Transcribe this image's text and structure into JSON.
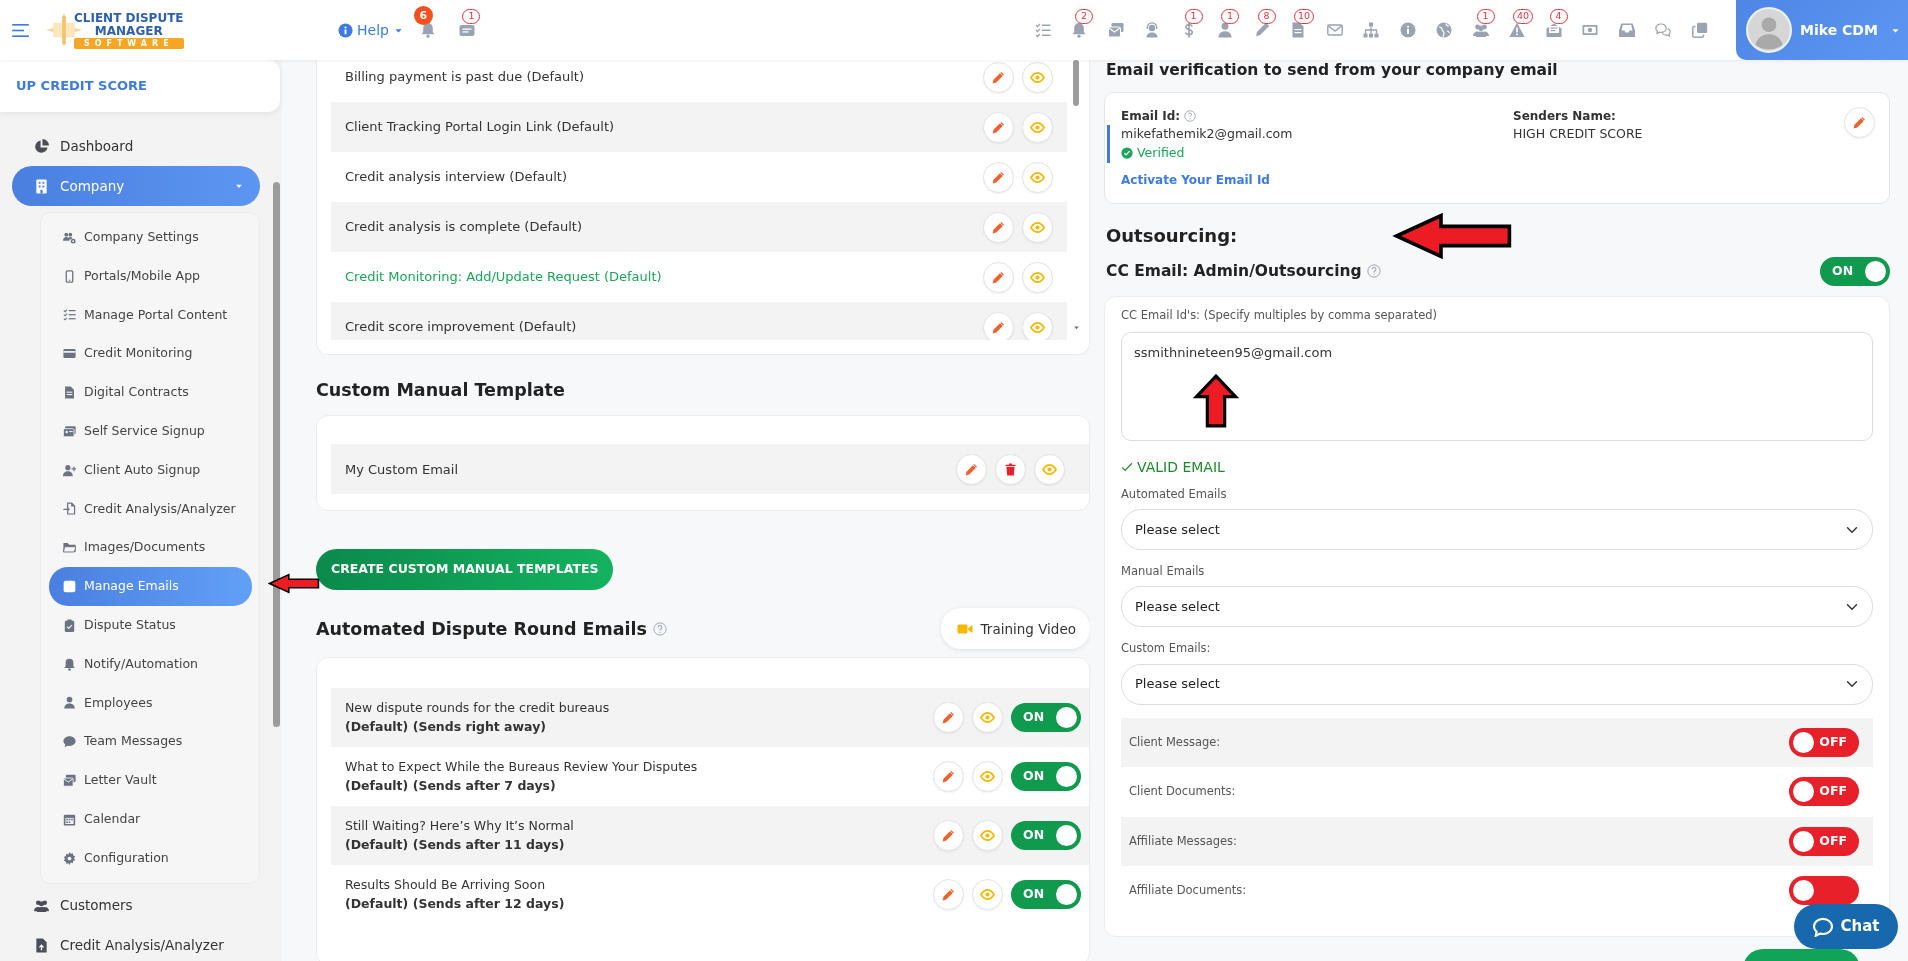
{
  "header": {
    "logo": {
      "line_1": "CLIENT DISPUTE",
      "line_2": "MANAGER",
      "line_3": "SOFTWARE"
    },
    "help": {
      "label": "Help"
    },
    "quick": [
      {
        "badge": "6"
      },
      {
        "badge": "1"
      }
    ],
    "icons": [
      {
        "badged": false
      },
      {
        "badged": true,
        "badge": "2"
      },
      {
        "badged": false
      },
      {
        "badged": false
      },
      {
        "badged": true,
        "badge": "1"
      },
      {
        "badged": true,
        "badge": "1"
      },
      {
        "badged": true,
        "badge": "8"
      },
      {
        "badged": true,
        "badge": "10"
      },
      {
        "badged": false
      },
      {
        "badged": false
      },
      {
        "badged": false
      },
      {
        "badged": false
      },
      {
        "badged": true,
        "badge": "1"
      },
      {
        "badged": true,
        "badge": "40"
      },
      {
        "badged": true,
        "badge": "4"
      },
      {
        "badged": false
      },
      {
        "badged": false
      },
      {
        "badged": false
      },
      {
        "badged": false
      }
    ],
    "user": {
      "name": "Mike CDM"
    }
  },
  "sidebar": {
    "account": "UP CREDIT SCORE",
    "items": [
      {
        "label": "Dashboard",
        "selected": false
      },
      {
        "label": "Company",
        "selected": true,
        "expanded": true,
        "children": [
          {
            "label": "Company Settings",
            "selected": false
          },
          {
            "label": "Portals/Mobile App",
            "selected": false
          },
          {
            "label": "Manage Portal Content",
            "selected": false
          },
          {
            "label": "Credit Monitoring",
            "selected": false
          },
          {
            "label": "Digital Contracts",
            "selected": false
          },
          {
            "label": "Self Service Signup",
            "selected": false
          },
          {
            "label": "Client Auto Signup",
            "selected": false
          },
          {
            "label": "Credit Analysis/Analyzer",
            "selected": false
          },
          {
            "label": "Images/Documents",
            "selected": false
          },
          {
            "label": "Manage Emails",
            "selected": true
          },
          {
            "label": "Dispute Status",
            "selected": false
          },
          {
            "label": "Notify/Automation",
            "selected": false
          },
          {
            "label": "Employees",
            "selected": false
          },
          {
            "label": "Team Messages",
            "selected": false
          },
          {
            "label": "Letter Vault",
            "selected": false
          },
          {
            "label": "Calendar",
            "selected": false
          },
          {
            "label": "Configuration",
            "selected": false
          }
        ]
      },
      {
        "label": "Customers",
        "selected": false
      },
      {
        "label": "Credit Analysis/Analyzer",
        "selected": false
      }
    ]
  },
  "templates": {
    "rows": [
      {
        "label": "Billing payment is past due (Default)",
        "highlighted": false
      },
      {
        "label": "Client Tracking Portal Login Link (Default)",
        "highlighted": false
      },
      {
        "label": "Credit analysis interview (Default)",
        "highlighted": false
      },
      {
        "label": "Credit analysis is complete (Default)",
        "highlighted": false
      },
      {
        "label": "Credit Monitoring: Add/Update Request (Default)",
        "highlighted": true
      },
      {
        "label": "Credit score improvement (Default)",
        "highlighted": false
      }
    ]
  },
  "custom_manual": {
    "title": "Custom Manual Template",
    "rows": [
      {
        "label": "My Custom Email"
      }
    ],
    "create_button": "CREATE CUSTOM MANUAL TEMPLATES"
  },
  "automated": {
    "title": "Automated Dispute Round Emails",
    "training_button": "Training Video",
    "rows": [
      {
        "title": "New dispute rounds for the credit bureaus",
        "subtitle": "(Default) (Sends right away)",
        "on": true,
        "toggle_label": "ON"
      },
      {
        "title": "What to Expect While the Bureaus Review Your Disputes",
        "subtitle": "(Default) (Sends after 7 days)",
        "on": true,
        "toggle_label": "ON"
      },
      {
        "title": "Still Waiting? Here’s Why It’s Normal",
        "subtitle": "(Default) (Sends after 11 days)",
        "on": true,
        "toggle_label": "ON"
      },
      {
        "title": "Results Should Be Arriving Soon",
        "subtitle": "(Default) (Sends after 12 days)",
        "on": true,
        "toggle_label": "ON"
      }
    ]
  },
  "verification": {
    "title": "Email verification to send from your company email",
    "email_label": "Email Id:",
    "email": "mikefathemik2@gmail.com",
    "status": "Verified",
    "activate_link": "Activate Your Email Id",
    "senders_label": "Senders Name:",
    "senders_name": "HIGH CREDIT SCORE"
  },
  "outsourcing": {
    "title": "Outsourcing:",
    "cc_title": "CC Email: Admin/Outsourcing",
    "cc_toggle": {
      "on": true,
      "label": "ON"
    },
    "cc_field": {
      "label": "CC Email Id's: (Specify multiples by comma separated)",
      "value": "ssmithnineteen95@gmail.com"
    },
    "validation": "VALID EMAIL",
    "selects": [
      {
        "label": "Automated Emails",
        "value": "Please select"
      },
      {
        "label": "Manual Emails",
        "value": "Please select"
      },
      {
        "label": "Custom Emails:",
        "value": "Please select"
      }
    ],
    "switches": [
      {
        "label": "Client Message:",
        "on": false,
        "toggle_label": "OFF"
      },
      {
        "label": "Client Documents:",
        "on": false,
        "toggle_label": "OFF"
      },
      {
        "label": "Affiliate Messages:",
        "on": false,
        "toggle_label": "OFF"
      },
      {
        "label": "Affiliate Documents:",
        "on": false
      }
    ]
  },
  "chat_button": {
    "label": "Chat"
  }
}
